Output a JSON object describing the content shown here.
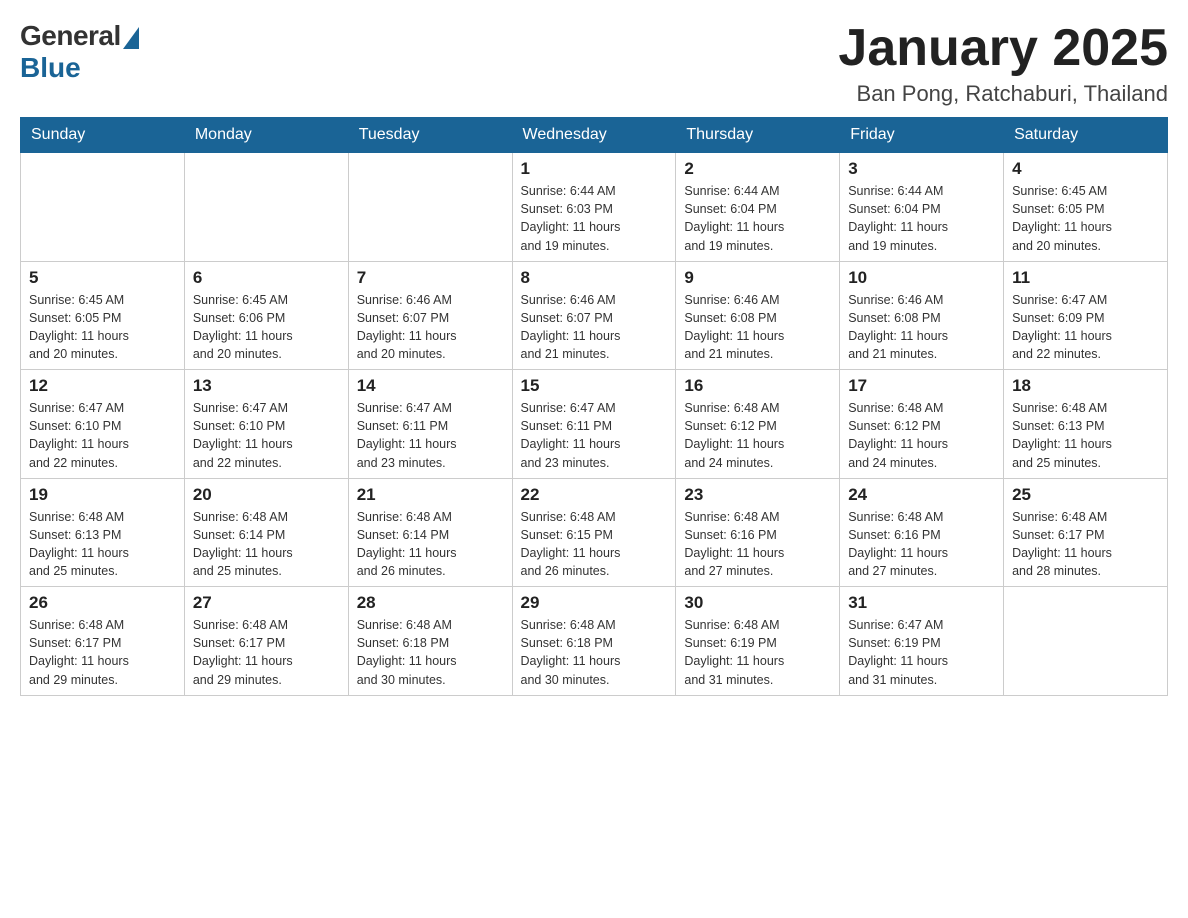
{
  "header": {
    "logo_general": "General",
    "logo_blue": "Blue",
    "month_year": "January 2025",
    "location": "Ban Pong, Ratchaburi, Thailand"
  },
  "weekdays": [
    "Sunday",
    "Monday",
    "Tuesday",
    "Wednesday",
    "Thursday",
    "Friday",
    "Saturday"
  ],
  "weeks": [
    [
      {
        "day": "",
        "info": ""
      },
      {
        "day": "",
        "info": ""
      },
      {
        "day": "",
        "info": ""
      },
      {
        "day": "1",
        "info": "Sunrise: 6:44 AM\nSunset: 6:03 PM\nDaylight: 11 hours\nand 19 minutes."
      },
      {
        "day": "2",
        "info": "Sunrise: 6:44 AM\nSunset: 6:04 PM\nDaylight: 11 hours\nand 19 minutes."
      },
      {
        "day": "3",
        "info": "Sunrise: 6:44 AM\nSunset: 6:04 PM\nDaylight: 11 hours\nand 19 minutes."
      },
      {
        "day": "4",
        "info": "Sunrise: 6:45 AM\nSunset: 6:05 PM\nDaylight: 11 hours\nand 20 minutes."
      }
    ],
    [
      {
        "day": "5",
        "info": "Sunrise: 6:45 AM\nSunset: 6:05 PM\nDaylight: 11 hours\nand 20 minutes."
      },
      {
        "day": "6",
        "info": "Sunrise: 6:45 AM\nSunset: 6:06 PM\nDaylight: 11 hours\nand 20 minutes."
      },
      {
        "day": "7",
        "info": "Sunrise: 6:46 AM\nSunset: 6:07 PM\nDaylight: 11 hours\nand 20 minutes."
      },
      {
        "day": "8",
        "info": "Sunrise: 6:46 AM\nSunset: 6:07 PM\nDaylight: 11 hours\nand 21 minutes."
      },
      {
        "day": "9",
        "info": "Sunrise: 6:46 AM\nSunset: 6:08 PM\nDaylight: 11 hours\nand 21 minutes."
      },
      {
        "day": "10",
        "info": "Sunrise: 6:46 AM\nSunset: 6:08 PM\nDaylight: 11 hours\nand 21 minutes."
      },
      {
        "day": "11",
        "info": "Sunrise: 6:47 AM\nSunset: 6:09 PM\nDaylight: 11 hours\nand 22 minutes."
      }
    ],
    [
      {
        "day": "12",
        "info": "Sunrise: 6:47 AM\nSunset: 6:10 PM\nDaylight: 11 hours\nand 22 minutes."
      },
      {
        "day": "13",
        "info": "Sunrise: 6:47 AM\nSunset: 6:10 PM\nDaylight: 11 hours\nand 22 minutes."
      },
      {
        "day": "14",
        "info": "Sunrise: 6:47 AM\nSunset: 6:11 PM\nDaylight: 11 hours\nand 23 minutes."
      },
      {
        "day": "15",
        "info": "Sunrise: 6:47 AM\nSunset: 6:11 PM\nDaylight: 11 hours\nand 23 minutes."
      },
      {
        "day": "16",
        "info": "Sunrise: 6:48 AM\nSunset: 6:12 PM\nDaylight: 11 hours\nand 24 minutes."
      },
      {
        "day": "17",
        "info": "Sunrise: 6:48 AM\nSunset: 6:12 PM\nDaylight: 11 hours\nand 24 minutes."
      },
      {
        "day": "18",
        "info": "Sunrise: 6:48 AM\nSunset: 6:13 PM\nDaylight: 11 hours\nand 25 minutes."
      }
    ],
    [
      {
        "day": "19",
        "info": "Sunrise: 6:48 AM\nSunset: 6:13 PM\nDaylight: 11 hours\nand 25 minutes."
      },
      {
        "day": "20",
        "info": "Sunrise: 6:48 AM\nSunset: 6:14 PM\nDaylight: 11 hours\nand 25 minutes."
      },
      {
        "day": "21",
        "info": "Sunrise: 6:48 AM\nSunset: 6:14 PM\nDaylight: 11 hours\nand 26 minutes."
      },
      {
        "day": "22",
        "info": "Sunrise: 6:48 AM\nSunset: 6:15 PM\nDaylight: 11 hours\nand 26 minutes."
      },
      {
        "day": "23",
        "info": "Sunrise: 6:48 AM\nSunset: 6:16 PM\nDaylight: 11 hours\nand 27 minutes."
      },
      {
        "day": "24",
        "info": "Sunrise: 6:48 AM\nSunset: 6:16 PM\nDaylight: 11 hours\nand 27 minutes."
      },
      {
        "day": "25",
        "info": "Sunrise: 6:48 AM\nSunset: 6:17 PM\nDaylight: 11 hours\nand 28 minutes."
      }
    ],
    [
      {
        "day": "26",
        "info": "Sunrise: 6:48 AM\nSunset: 6:17 PM\nDaylight: 11 hours\nand 29 minutes."
      },
      {
        "day": "27",
        "info": "Sunrise: 6:48 AM\nSunset: 6:17 PM\nDaylight: 11 hours\nand 29 minutes."
      },
      {
        "day": "28",
        "info": "Sunrise: 6:48 AM\nSunset: 6:18 PM\nDaylight: 11 hours\nand 30 minutes."
      },
      {
        "day": "29",
        "info": "Sunrise: 6:48 AM\nSunset: 6:18 PM\nDaylight: 11 hours\nand 30 minutes."
      },
      {
        "day": "30",
        "info": "Sunrise: 6:48 AM\nSunset: 6:19 PM\nDaylight: 11 hours\nand 31 minutes."
      },
      {
        "day": "31",
        "info": "Sunrise: 6:47 AM\nSunset: 6:19 PM\nDaylight: 11 hours\nand 31 minutes."
      },
      {
        "day": "",
        "info": ""
      }
    ]
  ]
}
